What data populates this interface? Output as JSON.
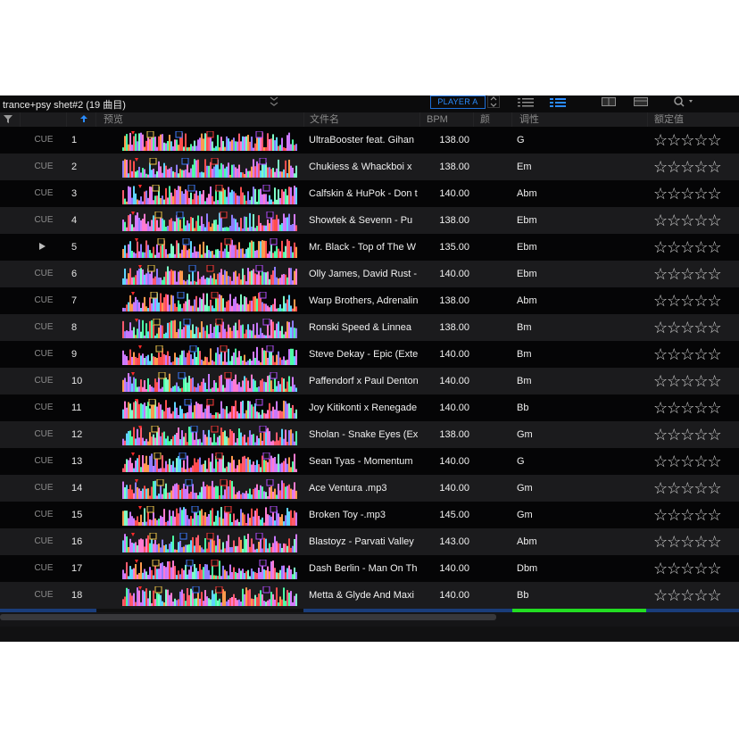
{
  "playlist": {
    "title": "trance+psy shet#2 (19 曲目)"
  },
  "toolbar": {
    "player_label": "PLAYER A"
  },
  "columns": {
    "preview": "预览",
    "filename": "文件名",
    "bpm": "BPM",
    "color": "颜",
    "key": "调性",
    "rating": "额定值"
  },
  "colors": {
    "accent": "#1d6fd9",
    "green_bar": "#22dd22",
    "blue_bar": "#1a3d7a"
  },
  "tracks": [
    {
      "cue": "CUE",
      "no": "1",
      "name": "UltraBooster feat. Gihan",
      "bpm": "138.00",
      "key": "G",
      "stars": "☆☆☆☆☆"
    },
    {
      "cue": "CUE",
      "no": "2",
      "name": "Chukiess & Whackboi x",
      "bpm": "138.00",
      "key": "Em",
      "stars": "☆☆☆☆☆"
    },
    {
      "cue": "CUE",
      "no": "3",
      "name": "Calfskin & HuPok - Don t",
      "bpm": "140.00",
      "key": "Abm",
      "stars": "☆☆☆☆☆"
    },
    {
      "cue": "CUE",
      "no": "4",
      "name": "Showtek & Sevenn - Pu",
      "bpm": "138.00",
      "key": "Ebm",
      "stars": "☆☆☆☆☆"
    },
    {
      "cue": "",
      "no": "5",
      "name": "Mr. Black - Top of The W",
      "bpm": "135.00",
      "key": "Ebm",
      "stars": "☆☆☆☆☆"
    },
    {
      "cue": "CUE",
      "no": "6",
      "name": "Olly James, David Rust -",
      "bpm": "140.00",
      "key": "Ebm",
      "stars": "☆☆☆☆☆"
    },
    {
      "cue": "CUE",
      "no": "7",
      "name": "Warp Brothers, Adrenalin",
      "bpm": "138.00",
      "key": "Abm",
      "stars": "☆☆☆☆☆"
    },
    {
      "cue": "CUE",
      "no": "8",
      "name": "Ronski Speed & Linnea",
      "bpm": "138.00",
      "key": "Bm",
      "stars": "☆☆☆☆☆"
    },
    {
      "cue": "CUE",
      "no": "9",
      "name": "Steve Dekay - Epic (Exte",
      "bpm": "140.00",
      "key": "Bm",
      "stars": "☆☆☆☆☆"
    },
    {
      "cue": "CUE",
      "no": "10",
      "name": "Paffendorf x Paul Denton",
      "bpm": "140.00",
      "key": "Bm",
      "stars": "☆☆☆☆☆"
    },
    {
      "cue": "CUE",
      "no": "11",
      "name": "Joy Kitikonti x Renegade",
      "bpm": "140.00",
      "key": "Bb",
      "stars": "☆☆☆☆☆"
    },
    {
      "cue": "CUE",
      "no": "12",
      "name": "Sholan - Snake Eyes (Ex",
      "bpm": "138.00",
      "key": "Gm",
      "stars": "☆☆☆☆☆"
    },
    {
      "cue": "CUE",
      "no": "13",
      "name": "Sean Tyas - Momentum",
      "bpm": "140.00",
      "key": "G",
      "stars": "☆☆☆☆☆"
    },
    {
      "cue": "CUE",
      "no": "14",
      "name": "Ace Ventura .mp3",
      "bpm": "140.00",
      "key": "Gm",
      "stars": "☆☆☆☆☆"
    },
    {
      "cue": "CUE",
      "no": "15",
      "name": "Broken Toy -.mp3",
      "bpm": "145.00",
      "key": "Gm",
      "stars": "☆☆☆☆☆"
    },
    {
      "cue": "CUE",
      "no": "16",
      "name": "Blastoyz - Parvati Valley",
      "bpm": "143.00",
      "key": "Abm",
      "stars": "☆☆☆☆☆"
    },
    {
      "cue": "CUE",
      "no": "17",
      "name": "Dash Berlin - Man On Th",
      "bpm": "140.00",
      "key": "Dbm",
      "stars": "☆☆☆☆☆"
    },
    {
      "cue": "CUE",
      "no": "18",
      "name": "Metta & Glyde And Maxi",
      "bpm": "140.00",
      "key": "Bb",
      "stars": "☆☆☆☆☆"
    }
  ]
}
